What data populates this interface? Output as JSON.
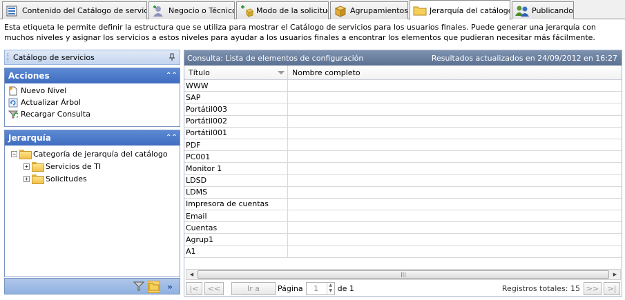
{
  "tabs": [
    {
      "label": "Contenido del Catálogo de servicios",
      "icon": "catalog-list-icon"
    },
    {
      "label": "Negocio o Técnico",
      "icon": "business-technical-icon"
    },
    {
      "label": "Modo de la solicitud",
      "icon": "request-mode-icon"
    },
    {
      "label": "Agrupamientos",
      "icon": "grouping-box-icon"
    },
    {
      "label": "Jerarquía del catálogo",
      "icon": "folder-icon",
      "active": true
    },
    {
      "label": "Publicando",
      "icon": "publishing-users-icon"
    }
  ],
  "description": "Esta etiqueta le permite definir la estructura que se utiliza para mostrar el Catálogo de servicios para los usuarios finales. Puede generar una jerarquía con muchos niveles y asignar los servicios a estos niveles para ayudar a los usuarios finales a encontrar los elementos que pudieran necesitar más fácilmente.",
  "left_panel": {
    "title": "Catálogo de servicios",
    "actions": {
      "title": "Acciones",
      "items": [
        "Nuevo Nivel",
        "Actualizar Árbol",
        "Recargar Consulta"
      ]
    },
    "hierarchy": {
      "title": "Jerarquía",
      "root": "Categoría de jerarquía del catálogo",
      "children": [
        "Servicios de TI",
        "Solicitudes"
      ]
    }
  },
  "grid": {
    "title": "Consulta: Lista de elementos de configuración",
    "updated": "Resultados actualizados en 24/09/2012 en 16:27",
    "columns": [
      "Título",
      "Nombre completo"
    ],
    "rows": [
      "WWW",
      "SAP",
      "Portátil003",
      "Portátil002",
      "Portátil001",
      "PDF",
      "PC001",
      "Monitor 1",
      "LDSD",
      "LDMS",
      "Impresora de cuentas",
      "Email",
      "Cuentas",
      "Agrup1",
      "A1"
    ]
  },
  "pager": {
    "first": "|<",
    "prev": "<<",
    "goto": "Ir a",
    "page_label": "Página",
    "page_value": "1",
    "of_label": "de 1",
    "total": "Registros totales: 15",
    "next": ">>",
    "last": ">|"
  }
}
